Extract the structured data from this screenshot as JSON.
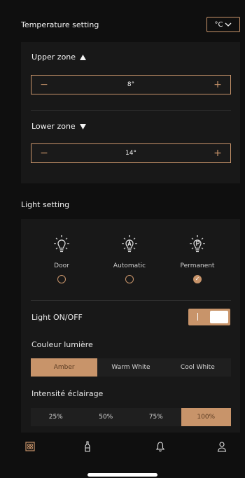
{
  "temperature": {
    "title": "Temperature setting",
    "unit": "°C",
    "upper_zone": {
      "label": "Upper zone",
      "value": "8°"
    },
    "lower_zone": {
      "label": "Lower zone",
      "value": "14°"
    }
  },
  "light": {
    "title": "Light setting",
    "modes": [
      {
        "label": "Door",
        "icon": "bulb-icon",
        "selected": false
      },
      {
        "label": "Automatic",
        "icon": "bulb-a-icon",
        "selected": false
      },
      {
        "label": "Permanent",
        "icon": "bulb-p-icon",
        "selected": true
      }
    ],
    "onoff_label": "Light ON/OFF",
    "onoff_state": true,
    "color_label": "Couleur lumière",
    "color_options": [
      "Amber",
      "Warm White",
      "Cool White"
    ],
    "color_selected": "Amber",
    "intensity_label": "Intensité éclairage",
    "intensity_options": [
      "25%",
      "50%",
      "75%",
      "100%"
    ],
    "intensity_selected": "100%"
  },
  "nav": {
    "items": [
      {
        "icon": "wine-cellar-icon",
        "active": true
      },
      {
        "icon": "bottle-icon",
        "active": false
      },
      {
        "icon": "bell-icon",
        "active": false
      },
      {
        "icon": "user-icon",
        "active": false
      }
    ]
  },
  "colors": {
    "accent": "#c8946a",
    "background": "#0f0f0f",
    "panel": "#181818"
  }
}
